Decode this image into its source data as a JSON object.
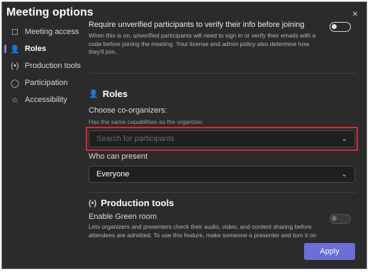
{
  "dialog": {
    "title": "Meeting options",
    "close_icon": "×"
  },
  "nav": {
    "items": [
      {
        "label": "Meeting access",
        "icon": "☐"
      },
      {
        "label": "Roles",
        "icon": "👤"
      },
      {
        "label": "Production tools",
        "icon": "(•)"
      },
      {
        "label": "Participation",
        "icon": "◯"
      },
      {
        "label": "Accessibility",
        "icon": "☆"
      }
    ]
  },
  "unverified": {
    "title": "Require unverified participants to verify their info before joining",
    "description": "When this is on, unverified participants will need to sign in or verify their emails with a code before joining the meeting. Your license and admin policy also determine how they'll join."
  },
  "roles": {
    "heading": "Roles",
    "choose_label": "Choose co-organizers:",
    "choose_hint": "Has the same capabilities as the organizer.",
    "search_placeholder": "Search for participants",
    "present_label": "Who can present",
    "present_value": "Everyone"
  },
  "production": {
    "heading": "Production tools",
    "green_room_label": "Enable Green room",
    "green_room_desc": "Lets organizers and presenters check their audio, video, and content sharing before attendees are admitted. To use this feature, make someone a presenter and turn it on"
  },
  "footer": {
    "apply_label": "Apply"
  },
  "colors": {
    "accent": "#6b6ed6",
    "highlight": "#d9263a",
    "background": "#2b2b2b"
  }
}
